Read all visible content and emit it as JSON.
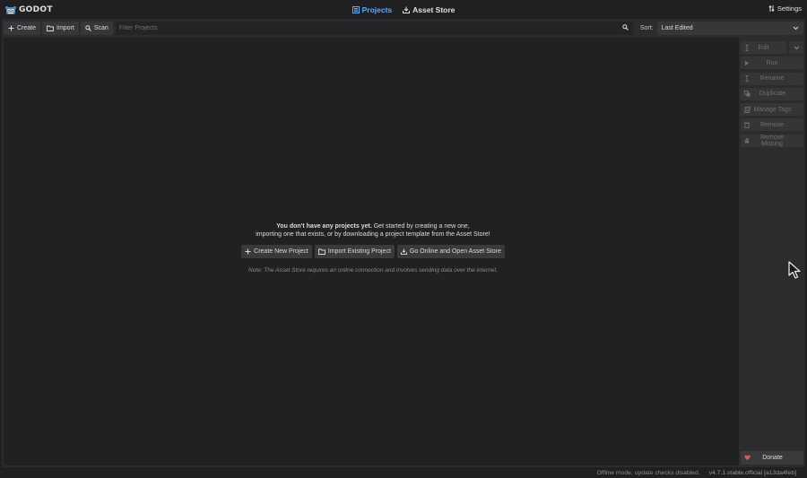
{
  "app": {
    "logo_text": "GODOT",
    "colors": {
      "accent": "#5fa9ff",
      "background": "#202022",
      "panel": "#2c2c2e",
      "danger": "#e05555"
    }
  },
  "tabs": [
    {
      "label": "Projects",
      "icon": "list-icon",
      "active": true
    },
    {
      "label": "Asset Store",
      "icon": "download-icon",
      "active": false
    }
  ],
  "settings": {
    "label": "Settings",
    "icon": "settings-sliders-icon"
  },
  "toolbar": {
    "create_label": "Create",
    "import_label": "Import",
    "scan_label": "Scan",
    "filter_placeholder": "Filter Projects",
    "sort_label": "Sort:",
    "sort_value": "Last Edited"
  },
  "sidebar": {
    "edit_label": "Edit",
    "run_label": "Run",
    "rename_label": "Rename",
    "duplicate_label": "Duplicate",
    "manage_tags_label": "Manage Tags",
    "remove_label": "Remove",
    "remove_missing_label": "Remove Missing",
    "donate_label": "Donate"
  },
  "empty_state": {
    "bold": "You don't have any projects yet.",
    "rest_line1": " Get started by creating a new one,",
    "line2": "importing one that exists, or by downloading a project template from the Asset Store!",
    "create_label": "Create New Project",
    "import_label": "Import Existing Project",
    "online_label": "Go Online and Open Asset Store",
    "note": "Note: The Asset Store requires an online connection and involves sending data over the internet."
  },
  "status": {
    "offline": "Offline mode, update checks disabled.",
    "version": "v4.7.1.stable.official [a13da4feb]"
  }
}
